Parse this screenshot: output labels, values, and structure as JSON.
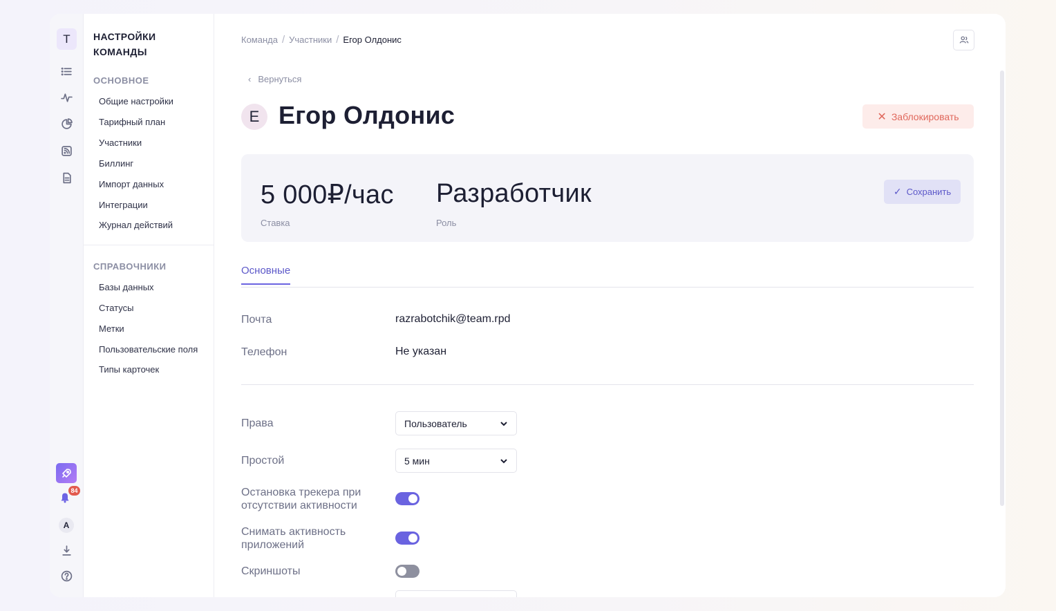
{
  "rail": {
    "logo_letter": "T",
    "icons": [
      "list-icon",
      "activity-icon",
      "pie-chart-icon",
      "rss-icon",
      "document-icon"
    ],
    "bottom_icons": [
      "rocket-icon",
      "bell-icon",
      "download-icon",
      "help-icon"
    ],
    "notifications_count": "84",
    "avatar_letter": "A"
  },
  "sidebar": {
    "title_line1": "НАСТРОЙКИ",
    "title_line2": "КОМАНДЫ",
    "section_main": "ОСНОВНОЕ",
    "main_items": [
      "Общие настройки",
      "Тарифный план",
      "Участники",
      "Биллинг",
      "Импорт данных",
      "Интеграции",
      "Журнал действий"
    ],
    "section_ref": "СПРАВОЧНИКИ",
    "ref_items": [
      "Базы данных",
      "Статусы",
      "Метки",
      "Пользовательские поля",
      "Типы карточек"
    ]
  },
  "breadcrumb": {
    "items": [
      "Команда",
      "Участники",
      "Егор Олдонис"
    ]
  },
  "back_label": "Вернуться",
  "person": {
    "avatar_letter": "E",
    "name": "Егор Олдонис"
  },
  "block_button": "Заблокировать",
  "summary": {
    "rate_value": "5 000₽/час",
    "rate_label": "Ставка",
    "role_value": "Разработчик",
    "role_label": "Роль",
    "save_label": "Сохранить"
  },
  "tabs": {
    "active": "Основные"
  },
  "contact": {
    "email_label": "Почта",
    "email_value": "razrabotchik@team.rpd",
    "phone_label": "Телефон",
    "phone_value": "Не указан"
  },
  "settings": {
    "rights_label": "Права",
    "rights_value": "Пользователь",
    "idle_label": "Простой",
    "idle_value": "5 мин",
    "stop_tracker_label_1": "Остановка трекера при",
    "stop_tracker_label_2": "отсутствии активности",
    "stop_tracker_on": true,
    "app_activity_label_1": "Снимать активность",
    "app_activity_label_2": "приложений",
    "app_activity_on": true,
    "screenshots_label": "Скриншоты",
    "screenshots_on": false
  },
  "colors": {
    "accent": "#6a63e0",
    "danger": "#e0685c",
    "badge": "#e25a4e"
  }
}
